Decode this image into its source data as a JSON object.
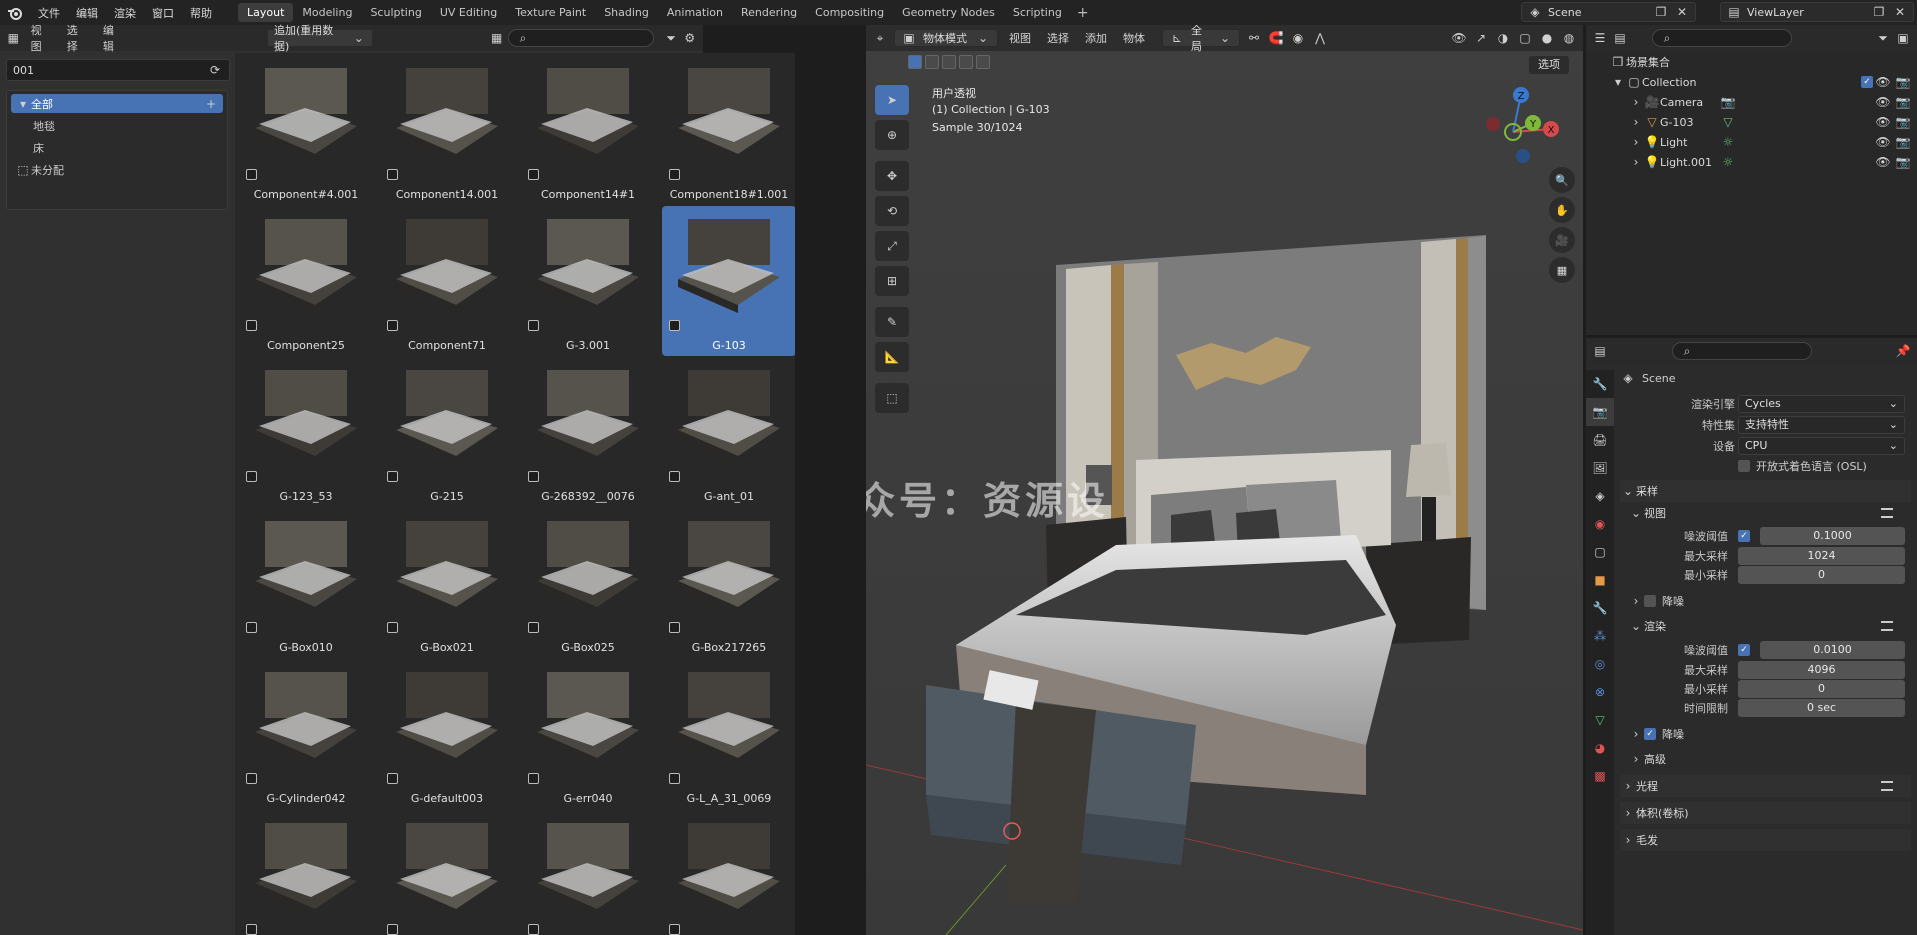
{
  "app": {
    "menus": [
      "文件",
      "编辑",
      "渲染",
      "窗口",
      "帮助"
    ],
    "workspaces": [
      "Layout",
      "Modeling",
      "Sculpting",
      "UV Editing",
      "Texture Paint",
      "Shading",
      "Animation",
      "Rendering",
      "Compositing",
      "Geometry Nodes",
      "Scripting"
    ],
    "active_workspace": "Layout",
    "scene": "Scene",
    "view_layer": "ViewLayer"
  },
  "asset_browser": {
    "header_menus": [
      "视图",
      "选择",
      "编辑"
    ],
    "import_mode": "追加(重用数据)",
    "library": "001",
    "categories": [
      {
        "label": "全部",
        "selected": true
      },
      {
        "label": "地毯",
        "selected": false
      },
      {
        "label": "床",
        "selected": false
      },
      {
        "label": "未分配",
        "selected": false
      }
    ],
    "assets": [
      "Component#4.001",
      "Component14.001",
      "Component14#1",
      "Component18#1.001",
      "Component25",
      "Component71",
      "G-3.001",
      "G-103",
      "G-123_53",
      "G-215",
      "G-268392__0076",
      "G-ant_01",
      "G-Box010",
      "G-Box021",
      "G-Box025",
      "G-Box217265",
      "G-Cylinder042",
      "G-default003",
      "G-err040",
      "G-L_A_31_0069",
      "",
      "",
      "",
      ""
    ],
    "selected_asset": "G-103"
  },
  "viewport": {
    "mode": "物体模式",
    "menus": [
      "视图",
      "选择",
      "添加",
      "物体"
    ],
    "orientation": "全局",
    "options_label": "选项",
    "view_name": "用户透视",
    "collection_info": "(1) Collection | G-103",
    "sample_info": "Sample 30/1024",
    "axis_labels": {
      "x": "X",
      "y": "Y",
      "z": "Z"
    },
    "watermark": "微信公众号：资源设"
  },
  "outliner": {
    "root": "场景集合",
    "items": [
      {
        "name": "Collection",
        "level": 0
      },
      {
        "name": "Camera",
        "level": 1
      },
      {
        "name": "G-103",
        "level": 1
      },
      {
        "name": "Light",
        "level": 1
      },
      {
        "name": "Light.001",
        "level": 1
      }
    ]
  },
  "properties": {
    "context": "Scene",
    "render_engine_label": "渲染引擎",
    "render_engine": "Cycles",
    "feature_set_label": "特性集",
    "feature_set": "支持特性",
    "device_label": "设备",
    "device": "CPU",
    "osl_label": "开放式着色语言 (OSL)",
    "sampling": "采样",
    "viewport_section": "视图",
    "noise_threshold_label": "噪波阈值",
    "viewport_noise_threshold": "0.1000",
    "max_samples_label": "最大采样",
    "viewport_max_samples": "1024",
    "min_samples_label": "最小采样",
    "viewport_min_samples": "0",
    "denoise_label": "降噪",
    "render_section": "渲染",
    "render_noise_threshold": "0.0100",
    "render_max_samples": "4096",
    "render_min_samples": "0",
    "time_limit_label": "时间限制",
    "time_limit": "0 sec",
    "advanced": "高级",
    "light_paths": "光程",
    "volumes": "体积(卷标)",
    "hair": "毛发"
  }
}
